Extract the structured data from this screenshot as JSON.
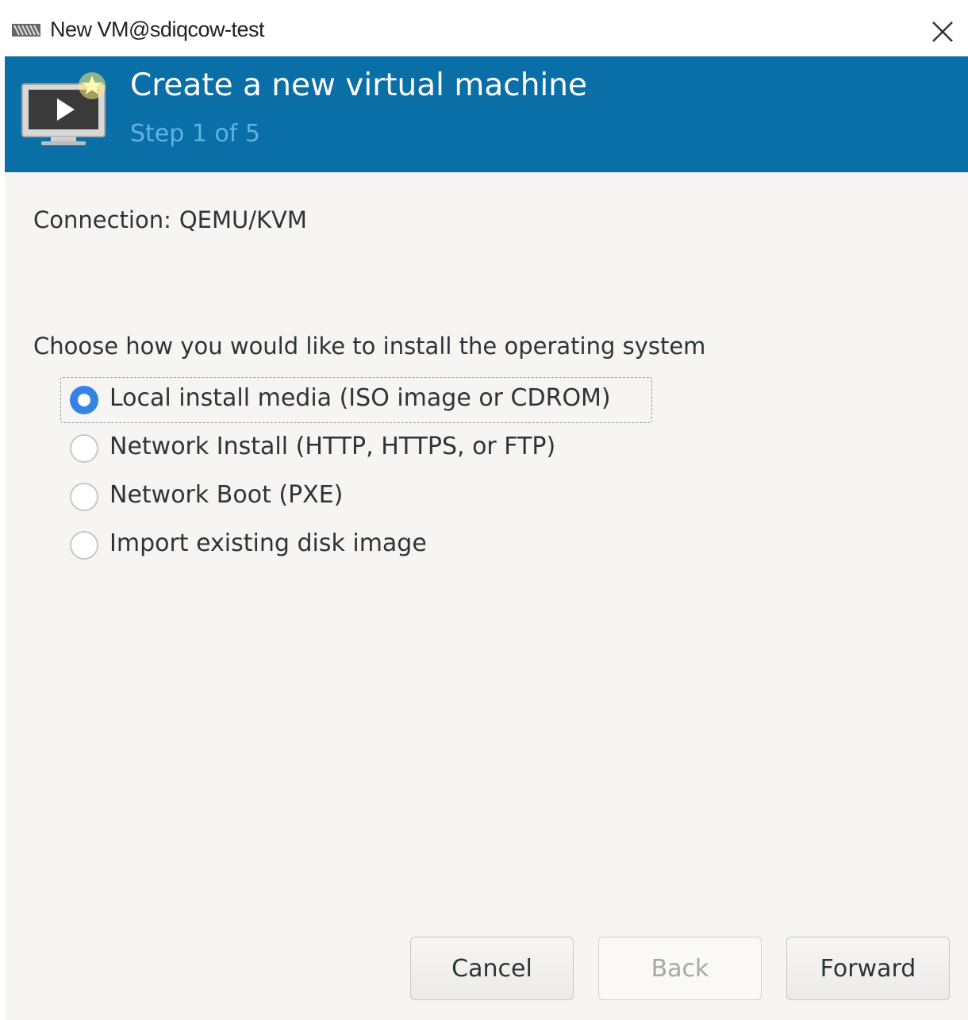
{
  "window": {
    "title": "New VM@sdiqcow-test",
    "icons": {
      "app": "virt-manager-icon",
      "close": "close-icon"
    }
  },
  "header": {
    "title": "Create a new virtual machine",
    "step": "Step 1 of 5",
    "icon": "new-vm-monitor-icon",
    "background_color": "#0a6fa7"
  },
  "connection": {
    "label": "Connection:",
    "value": "QEMU/KVM"
  },
  "install": {
    "prompt": "Choose how you would like to install the operating system",
    "options": [
      {
        "label": "Local install media (ISO image or CDROM)",
        "selected": true
      },
      {
        "label": "Network Install (HTTP, HTTPS, or FTP)",
        "selected": false
      },
      {
        "label": "Network Boot (PXE)",
        "selected": false
      },
      {
        "label": "Import existing disk image",
        "selected": false
      }
    ]
  },
  "buttons": {
    "cancel": "Cancel",
    "back": "Back",
    "forward": "Forward",
    "back_disabled": true
  },
  "colors": {
    "accent": "#3584e4",
    "step_text": "#5fb2e6"
  }
}
